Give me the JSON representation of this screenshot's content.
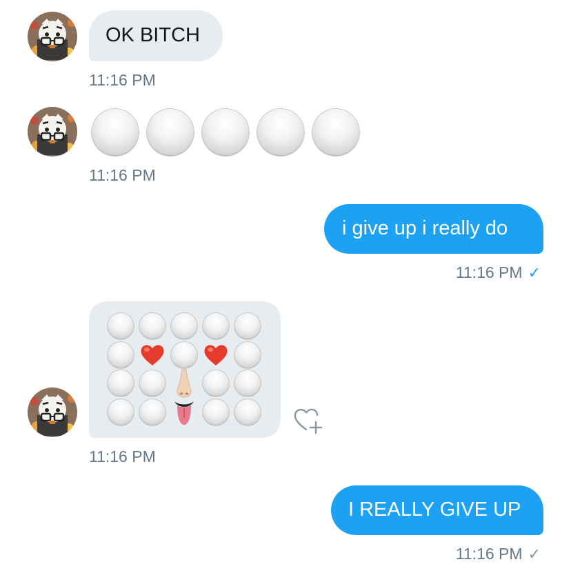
{
  "colors": {
    "incoming_bubble": "#e6ecf0",
    "outgoing_bubble": "#1da1f2",
    "timestamp": "#657786",
    "read_check": "#1da1f2",
    "sent_check": "#8899a6"
  },
  "conversation": {
    "messages": [
      {
        "direction": "incoming",
        "type": "text",
        "text": "OK BITCH",
        "time": "11:16 PM"
      },
      {
        "direction": "incoming",
        "type": "emoji-row",
        "emoji": [
          "white-circle",
          "white-circle",
          "white-circle",
          "white-circle",
          "white-circle"
        ],
        "time": "11:16 PM"
      },
      {
        "direction": "outgoing",
        "type": "text",
        "text": "i give up i really do",
        "time": "11:16 PM",
        "status": "read-check-icon"
      },
      {
        "direction": "incoming",
        "type": "emoji-grid",
        "emoji_rows": [
          [
            "white-circle",
            "white-circle",
            "white-circle",
            "white-circle",
            "white-circle"
          ],
          [
            "white-circle",
            "red-heart",
            "white-circle",
            "red-heart",
            "white-circle"
          ],
          [
            "white-circle",
            "white-circle",
            "nose",
            "white-circle",
            "white-circle"
          ],
          [
            "white-circle",
            "white-circle",
            "tongue",
            "white-circle",
            "white-circle"
          ]
        ],
        "time": "11:16 PM",
        "action": "like-heart-add-icon"
      },
      {
        "direction": "outgoing",
        "type": "text",
        "text": "I REALLY GIVE UP",
        "time": "11:16 PM",
        "status": "sent-check-icon"
      }
    ]
  }
}
